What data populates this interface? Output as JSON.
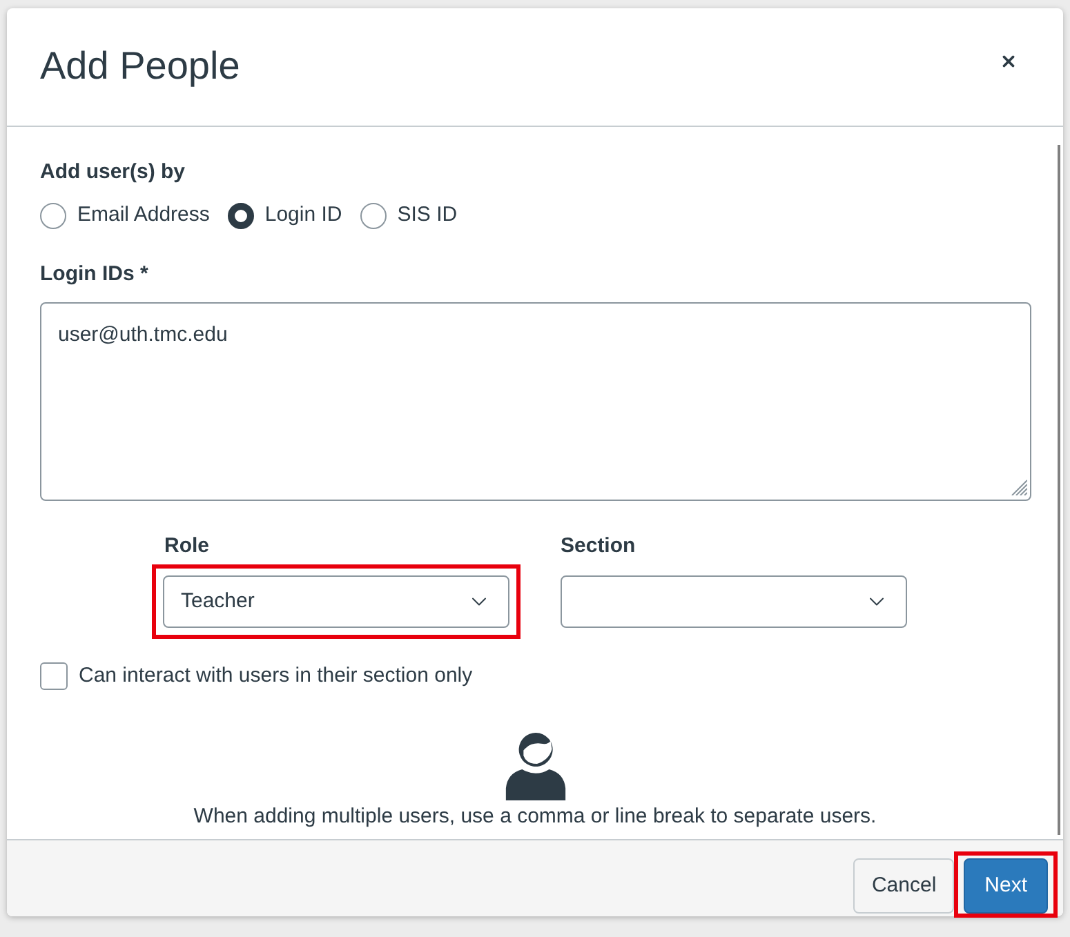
{
  "dialog": {
    "title": "Add People"
  },
  "add_by": {
    "label": "Add user(s) by",
    "options": [
      {
        "label": "Email Address",
        "selected": false
      },
      {
        "label": "Login ID",
        "selected": true
      },
      {
        "label": "SIS ID",
        "selected": false
      }
    ]
  },
  "ids_field": {
    "label": "Login IDs *",
    "value": "user@uth.tmc.edu"
  },
  "role": {
    "label": "Role",
    "value": "Teacher",
    "highlighted": true
  },
  "section": {
    "label": "Section",
    "highlighted": false
  },
  "limit_checkbox": {
    "label": "Can interact with users in their section only",
    "checked": false
  },
  "hint": "When adding multiple users, use a comma or line break to separate users.",
  "buttons": [
    {
      "label": "Cancel",
      "kind": "secondary",
      "highlighted": false
    },
    {
      "label": "Next",
      "kind": "primary",
      "highlighted": true
    }
  ]
}
